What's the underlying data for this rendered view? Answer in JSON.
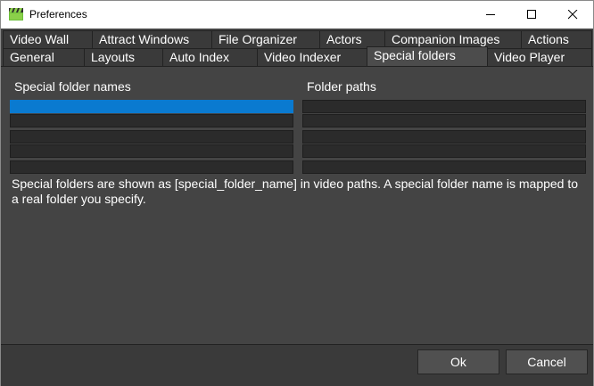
{
  "window": {
    "title": "Preferences",
    "app_icon": "clapperboard-icon",
    "controls": [
      "minimize-icon",
      "maximize-icon",
      "close-icon"
    ]
  },
  "tabs": {
    "row1": [
      "Video Wall",
      "Attract Windows",
      "File Organizer",
      "Actors",
      "Companion Images",
      "Actions"
    ],
    "row2": [
      "General",
      "Layouts",
      "Auto Index",
      "Video Indexer",
      "Special folders",
      "Video Player"
    ],
    "active": "Special folders"
  },
  "special_folders": {
    "names_label": "Special folder names",
    "paths_label": "Folder paths",
    "description": "Special folders are shown as [special_folder_name] in video paths. A special folder name is mapped to a real folder you specify."
  },
  "footer": {
    "ok_label": "Ok",
    "cancel_label": "Cancel"
  },
  "colors": {
    "background": "#444444",
    "field": "#2b2b2b",
    "selection": "#0a7ad0"
  }
}
